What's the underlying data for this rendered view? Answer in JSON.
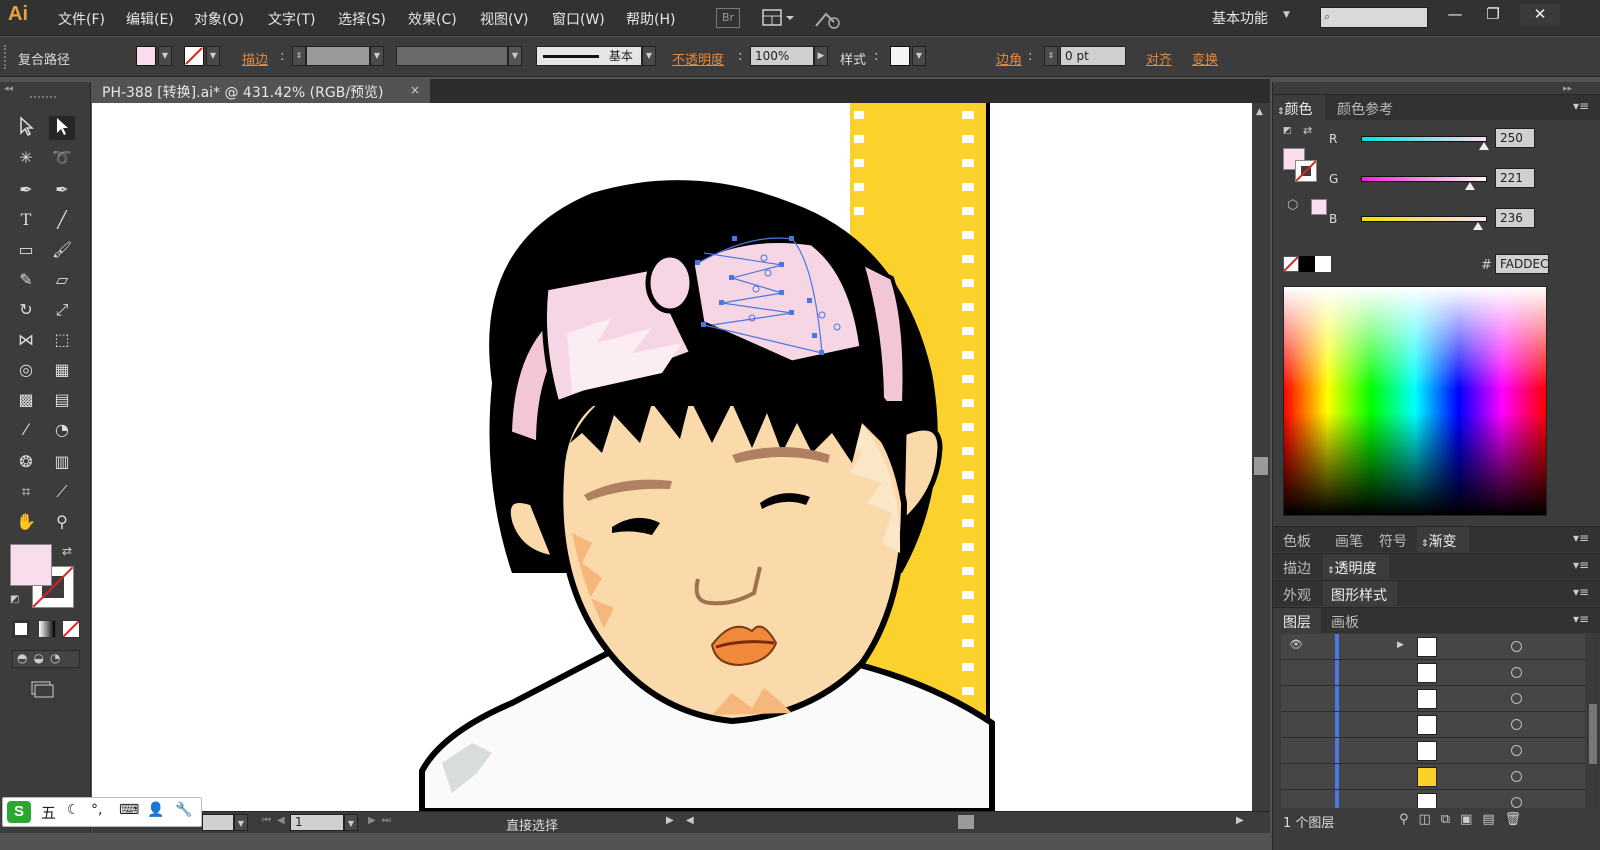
{
  "app": {
    "logo": "Ai",
    "workspace": "基本功能"
  },
  "menu": [
    "文件(F)",
    "编辑(E)",
    "对象(O)",
    "文字(T)",
    "选择(S)",
    "效果(C)",
    "视图(V)",
    "窗口(W)",
    "帮助(H)"
  ],
  "menu_icons": {
    "bridge": "Br"
  },
  "window_buttons": {
    "minimize": "—",
    "restore": "❐",
    "close": "✕"
  },
  "control": {
    "object_type": "复合路径",
    "stroke_label": "描边",
    "stroke_style": "基本",
    "opacity_label": "不透明度",
    "opacity_value": "100%",
    "style_label": "样式",
    "corner_label": "边角",
    "corner_value": "0 pt",
    "align_label": "对齐",
    "transform_label": "变换",
    "fill_color": "#FADDEC"
  },
  "document": {
    "tab_title": "PH-388 [转换].ai* @ 431.42% (RGB/预览)",
    "close": "×",
    "status_tool": "直接选择",
    "artboard_number": "1"
  },
  "panels": {
    "color_tabs": [
      "颜色",
      "颜色参考"
    ],
    "rgb": [
      {
        "channel": "R",
        "value": "250",
        "fraction": 0.98
      },
      {
        "channel": "G",
        "value": "221",
        "fraction": 0.867
      },
      {
        "channel": "B",
        "value": "236",
        "fraction": 0.925
      }
    ],
    "hex_label": "#",
    "hex_value": "FADDEC",
    "swatch_tabs": [
      "色板",
      "画笔",
      "符号",
      "渐变"
    ],
    "stroke_tabs": [
      "描边",
      "透明度"
    ],
    "appearance_tabs": [
      "外观",
      "图形样式"
    ],
    "layer_tabs": [
      "图层",
      "画板"
    ],
    "layers_count": "1 个图层"
  },
  "ime": {
    "label": "五"
  },
  "colors": {
    "film_yellow": "#FBD22B",
    "bow_pink": "#F6D5E4",
    "skin": "#FADAAA",
    "hair": "#000000",
    "accent_orange": "#E8883A"
  }
}
